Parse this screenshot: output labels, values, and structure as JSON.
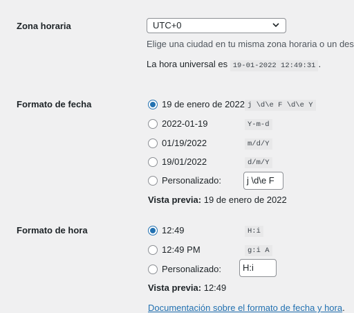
{
  "timezone": {
    "label": "Zona horaria",
    "selected": "UTC+0",
    "help": "Elige una ciudad en tu misma zona horaria o un desfase",
    "universal_prefix": "La hora universal es",
    "universal_time": "19-01-2022 12:49:31",
    "universal_suffix": "."
  },
  "date_format": {
    "label": "Formato de fecha",
    "options": [
      {
        "text": "19 de enero de 2022",
        "code": "j \\d\\e F \\d\\e Y",
        "checked": true
      },
      {
        "text": "2022-01-19",
        "code": "Y-m-d",
        "checked": false
      },
      {
        "text": "01/19/2022",
        "code": "m/d/Y",
        "checked": false
      },
      {
        "text": "19/01/2022",
        "code": "d/m/Y",
        "checked": false
      }
    ],
    "custom_label": "Personalizado:",
    "custom_value": "j \\d\\e F",
    "preview_label": "Vista previa:",
    "preview_value": "19 de enero de 2022"
  },
  "time_format": {
    "label": "Formato de hora",
    "options": [
      {
        "text": "12:49",
        "code": "H:i",
        "checked": true
      },
      {
        "text": "12:49 PM",
        "code": "g:i A",
        "checked": false
      }
    ],
    "custom_label": "Personalizado:",
    "custom_value": "H:i",
    "preview_label": "Vista previa:",
    "preview_value": "12:49"
  },
  "doc_link": {
    "text": "Documentación sobre el formato de fecha y hora",
    "suffix": "."
  },
  "colors": {
    "accent": "#2271b1",
    "background": "#f0f0f1"
  },
  "icons": {
    "select": "chevron-down-icon"
  }
}
